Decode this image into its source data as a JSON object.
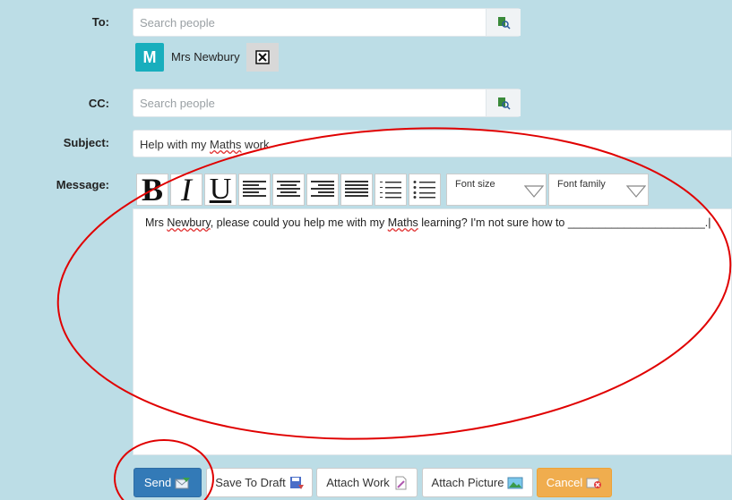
{
  "to": {
    "label": "To:",
    "placeholder": "Search people",
    "recipient": {
      "initial": "M",
      "name": "Mrs Newbury",
      "remove_icon": "close-box-icon"
    },
    "lookup_icon": "address-book-search-icon"
  },
  "cc": {
    "label": "CC:",
    "placeholder": "Search people",
    "lookup_icon": "address-book-search-icon"
  },
  "subject": {
    "label": "Subject:",
    "value_before": "Help with my ",
    "value_misspelled": "Maths",
    "value_after": " work"
  },
  "message": {
    "label": "Message:",
    "text_1": "Mrs ",
    "text_2": "Newbury",
    "text_3": ", please could you help me with my ",
    "text_4": "Maths",
    "text_5": " learning? I'm not sure how to ______________________.|"
  },
  "toolbar": {
    "bold": "B",
    "italic": "I",
    "underline": "U",
    "font_size": "Font size",
    "font_family": "Font family"
  },
  "buttons": {
    "send": "Send",
    "save_draft": "Save To Draft",
    "attach_work": "Attach Work",
    "attach_picture": "Attach Picture",
    "cancel": "Cancel"
  },
  "colors": {
    "background": "#bcdde6",
    "send": "#337ab7",
    "cancel": "#f0ad4e",
    "annotation": "#e00000",
    "chip": "#18aebd"
  }
}
